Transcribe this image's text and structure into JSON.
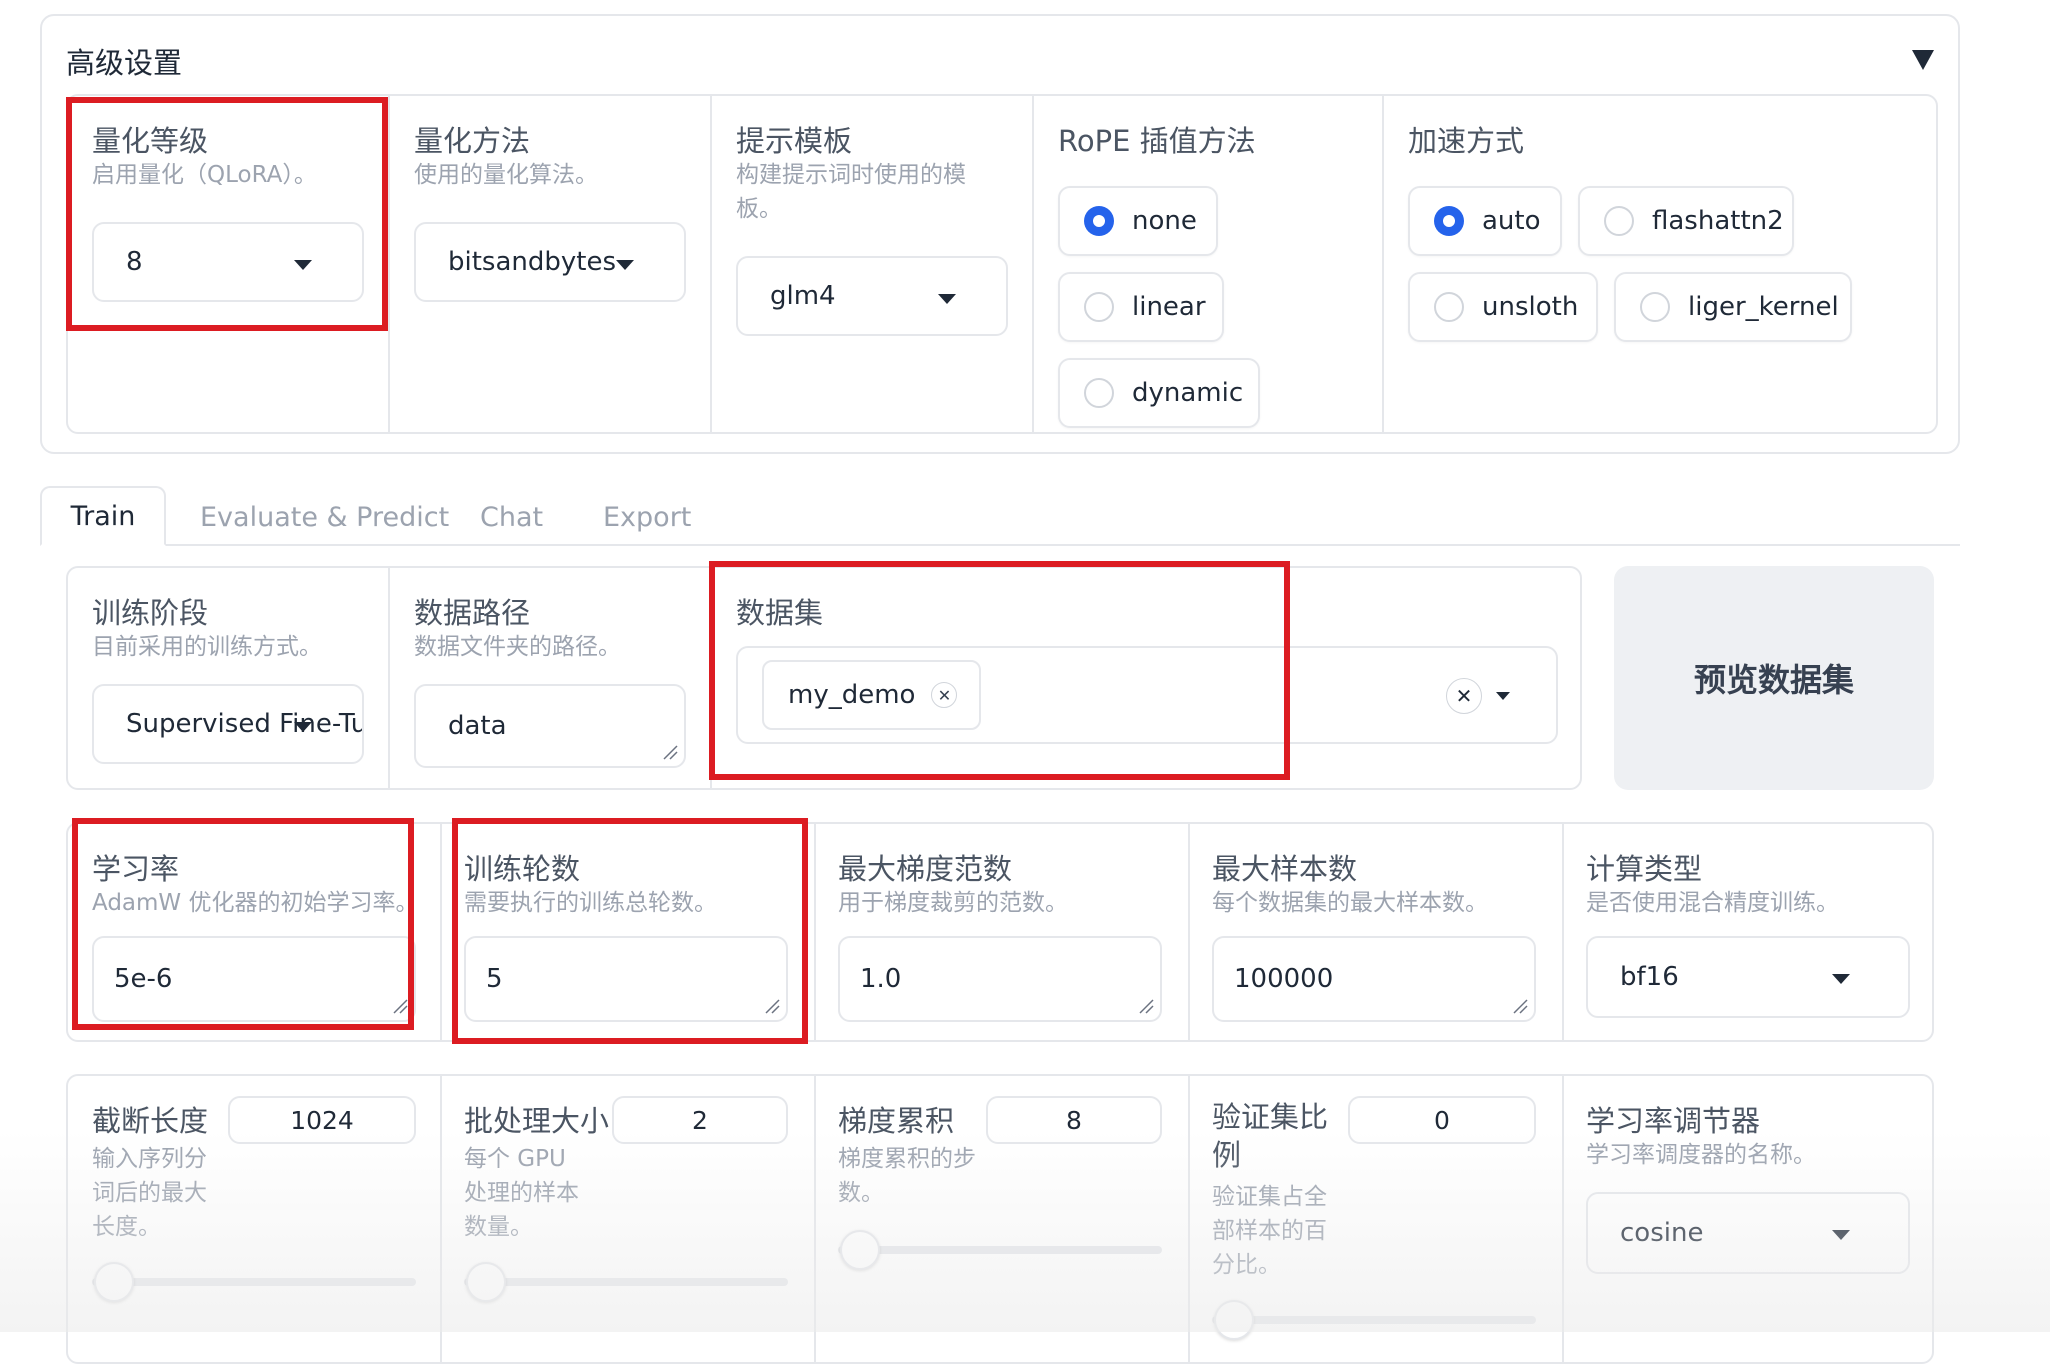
{
  "advanced": {
    "title": "高级设置",
    "quant_bit": {
      "label": "量化等级",
      "info": "启用量化（QLoRA）。",
      "value": "8"
    },
    "quant_method": {
      "label": "量化方法",
      "info": "使用的量化算法。",
      "value": "bitsandbytes"
    },
    "template": {
      "label": "提示模板",
      "info": "构建提示词时使用的模板。",
      "value": "glm4"
    },
    "rope": {
      "label": "RoPE 插值方法",
      "options": [
        "none",
        "linear",
        "dynamic"
      ],
      "selected": "none"
    },
    "booster": {
      "label": "加速方式",
      "options": [
        "auto",
        "flashattn2",
        "unsloth",
        "liger_kernel"
      ],
      "selected": "auto"
    }
  },
  "tabs": [
    "Train",
    "Evaluate & Predict",
    "Chat",
    "Export"
  ],
  "active_tab": "Train",
  "train": {
    "stage": {
      "label": "训练阶段",
      "info": "目前采用的训练方式。",
      "value": "Supervised Fine-Tuning"
    },
    "dataset_dir": {
      "label": "数据路径",
      "info": "数据文件夹的路径。",
      "value": "data"
    },
    "dataset": {
      "label": "数据集",
      "chips": [
        "my_demo"
      ]
    },
    "preview_button": "预览数据集",
    "learning_rate": {
      "label": "学习率",
      "info": "AdamW 优化器的初始学习率。",
      "value": "5e-6"
    },
    "epochs": {
      "label": "训练轮数",
      "info": "需要执行的训练总轮数。",
      "value": "5"
    },
    "max_grad_norm": {
      "label": "最大梯度范数",
      "info": "用于梯度裁剪的范数。",
      "value": "1.0"
    },
    "max_samples": {
      "label": "最大样本数",
      "info": "每个数据集的最大样本数。",
      "value": "100000"
    },
    "compute_type": {
      "label": "计算类型",
      "info": "是否使用混合精度训练。",
      "value": "bf16"
    },
    "cutoff_len": {
      "label": "截断长度",
      "info": "输入序列分词后的最大长度。",
      "value": "1024",
      "slider": 0.01
    },
    "batch_size": {
      "label": "批处理大小",
      "info": "每个 GPU 处理的样本数量。",
      "value": "2",
      "slider": 0.0
    },
    "grad_accum": {
      "label": "梯度累积",
      "info": "梯度累积的步数。",
      "value": "8",
      "slider": 0.03
    },
    "val_size": {
      "label": "验证集比例",
      "info": "验证集占全部样本的百分比。",
      "value": "0",
      "slider": 0.0
    },
    "lr_scheduler": {
      "label": "学习率调节器",
      "info": "学习率调度器的名称。",
      "value": "cosine"
    }
  },
  "colors": {
    "accent": "#2563eb",
    "highlight_border": "#dc1c22",
    "border": "#e5e7eb"
  }
}
